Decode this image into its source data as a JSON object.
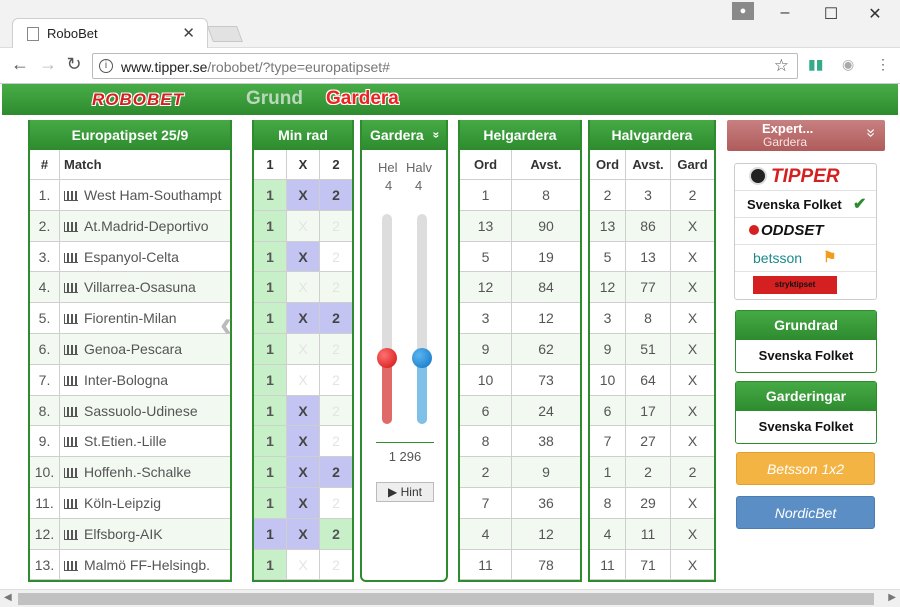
{
  "browser": {
    "tab_title": "RoboBet",
    "tab_close": "✕",
    "url_host": "www.tipper.se",
    "url_path": "/robobet/?type=europatipset#",
    "min": "–",
    "max": "☐",
    "close": "✕"
  },
  "site": {
    "logo": "ROBOBET",
    "nav_grund": "Grund",
    "nav_gardera": "Gardera"
  },
  "coupon": {
    "title": "Europatipset 25/9",
    "col_num": "#",
    "col_match": "Match",
    "matches": [
      {
        "num": "1.",
        "name": "West Ham-Southampt"
      },
      {
        "num": "2.",
        "name": "At.Madrid-Deportivo"
      },
      {
        "num": "3.",
        "name": "Espanyol-Celta"
      },
      {
        "num": "4.",
        "name": "Villarrea-Osasuna"
      },
      {
        "num": "5.",
        "name": "Fiorentin-Milan"
      },
      {
        "num": "6.",
        "name": "Genoa-Pescara"
      },
      {
        "num": "7.",
        "name": "Inter-Bologna"
      },
      {
        "num": "8.",
        "name": "Sassuolo-Udinese"
      },
      {
        "num": "9.",
        "name": "St.Etien.-Lille"
      },
      {
        "num": "10.",
        "name": "Hoffenh.-Schalke"
      },
      {
        "num": "11.",
        "name": "Köln-Leipzig"
      },
      {
        "num": "12.",
        "name": "Elfsborg-AIK"
      },
      {
        "num": "13.",
        "name": "Malmö FF-Helsingb."
      }
    ]
  },
  "minrad": {
    "title": "Min rad",
    "cols": [
      "1",
      "X",
      "2"
    ],
    "rows": [
      [
        "1",
        "X",
        "2"
      ],
      [
        "1",
        "X",
        "2"
      ],
      [
        "1",
        "X",
        "2"
      ],
      [
        "1",
        "X",
        "2"
      ],
      [
        "1",
        "X",
        "2"
      ],
      [
        "1",
        "X",
        "2"
      ],
      [
        "1",
        "X",
        "2"
      ],
      [
        "1",
        "X",
        "2"
      ],
      [
        "1",
        "X",
        "2"
      ],
      [
        "1",
        "X",
        "2"
      ],
      [
        "1",
        "X",
        "2"
      ],
      [
        "1",
        "X",
        "2"
      ],
      [
        "1",
        "X",
        "2"
      ]
    ],
    "states": [
      [
        "g",
        "b",
        "b"
      ],
      [
        "g",
        "o",
        "o"
      ],
      [
        "g",
        "b",
        "o"
      ],
      [
        "g",
        "o",
        "o"
      ],
      [
        "g",
        "b",
        "b"
      ],
      [
        "g",
        "o",
        "o"
      ],
      [
        "g",
        "o",
        "o"
      ],
      [
        "g",
        "b",
        "o"
      ],
      [
        "g",
        "b",
        "o"
      ],
      [
        "g",
        "b",
        "b"
      ],
      [
        "g",
        "b",
        "o"
      ],
      [
        "b",
        "b",
        "g"
      ],
      [
        "g",
        "o",
        "o"
      ]
    ]
  },
  "gardera": {
    "title": "Gardera",
    "chevron": "»",
    "hel_label": "Hel",
    "halv_label": "Halv",
    "hel_value": "4",
    "halv_value": "4",
    "total": "1 296",
    "hint": "▶ Hint",
    "hel_color": "#e01e1e",
    "halv_color": "#1e8ad2"
  },
  "helgardera": {
    "title": "Helgardera",
    "col_ord": "Ord",
    "col_avst": "Avst.",
    "rows": [
      [
        "1",
        "8"
      ],
      [
        "13",
        "90"
      ],
      [
        "5",
        "19"
      ],
      [
        "12",
        "84"
      ],
      [
        "3",
        "12"
      ],
      [
        "9",
        "62"
      ],
      [
        "10",
        "73"
      ],
      [
        "6",
        "24"
      ],
      [
        "8",
        "38"
      ],
      [
        "2",
        "9"
      ],
      [
        "7",
        "36"
      ],
      [
        "4",
        "12"
      ],
      [
        "11",
        "78"
      ]
    ]
  },
  "halvgardera": {
    "title": "Halvgardera",
    "col_ord": "Ord",
    "col_avst": "Avst.",
    "col_gard": "Gard",
    "rows": [
      [
        "2",
        "3",
        "2"
      ],
      [
        "13",
        "86",
        "X"
      ],
      [
        "5",
        "13",
        "X"
      ],
      [
        "12",
        "77",
        "X"
      ],
      [
        "3",
        "8",
        "X"
      ],
      [
        "9",
        "51",
        "X"
      ],
      [
        "10",
        "64",
        "X"
      ],
      [
        "6",
        "17",
        "X"
      ],
      [
        "7",
        "27",
        "X"
      ],
      [
        "1",
        "2",
        "2"
      ],
      [
        "8",
        "29",
        "X"
      ],
      [
        "4",
        "11",
        "X"
      ],
      [
        "11",
        "71",
        "X"
      ]
    ]
  },
  "sidebar": {
    "expert_title": "Expert...",
    "expert_sub": "Gardera",
    "expert_chev": "»",
    "brands": [
      "TIPPER",
      "Svenska Folket",
      "ODDSET",
      "betsson",
      "stryktipset"
    ],
    "check": "✔",
    "grundrad_title": "Grundrad",
    "grundrad_brand": "Svenska Folket",
    "garderingar_title": "Garderingar",
    "garderingar_brand": "Svenska Folket",
    "betsson_btn": "Betsson 1x2",
    "nordic_btn": "NordicBet"
  }
}
